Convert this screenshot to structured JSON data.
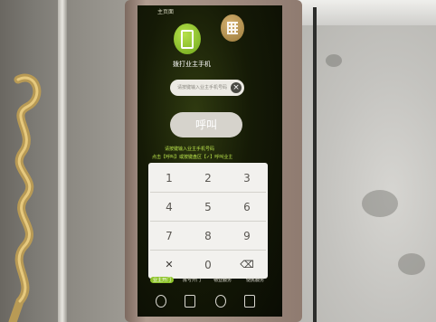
{
  "screen": {
    "header_text": "主页面",
    "call_owner_label": "拨打业主手机",
    "input_placeholder": "请按键输入业主手机号码",
    "clear_symbol": "×",
    "call_button_label": "呼叫",
    "hint_line1": "请按键输入业主手机号码",
    "hint_line2": "点击【呼叫】或按键盘区【✓】呼叫业主"
  },
  "keypad": {
    "rows": [
      [
        "1",
        "2",
        "3"
      ],
      [
        "4",
        "5",
        "6"
      ],
      [
        "7",
        "8",
        "9"
      ],
      [
        "✕",
        "0",
        "⌫"
      ]
    ]
  },
  "tabs": [
    {
      "label": "业主开门",
      "active": true
    },
    {
      "label": "房号开门",
      "active": false
    },
    {
      "label": "物业服务",
      "active": false
    },
    {
      "label": "便民服务",
      "active": false
    }
  ],
  "nav_icons": [
    "phone-icon",
    "building-icon",
    "home-icon",
    "grid-icon"
  ],
  "colors": {
    "accent_green": "#8ec42a",
    "screen_bg": "#0f1305"
  }
}
